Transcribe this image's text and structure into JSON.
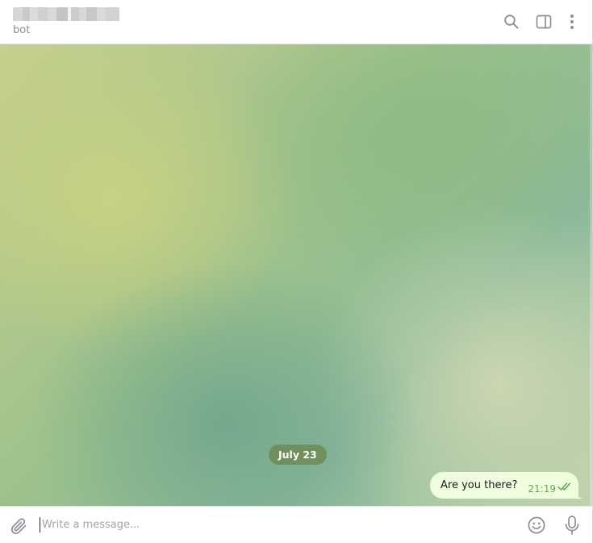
{
  "header": {
    "status": "bot",
    "icons": [
      "search-icon",
      "sidebar-toggle-icon",
      "more-vertical-icon"
    ]
  },
  "chat": {
    "date_label": "July 23",
    "messages": [
      {
        "text": "Are you there?",
        "time": "21:19",
        "outgoing": true,
        "status": "read"
      }
    ]
  },
  "composer": {
    "placeholder": "Write a message...",
    "icons": [
      "paperclip-icon",
      "emoji-icon",
      "microphone-icon"
    ]
  },
  "colors": {
    "outgoing_bubble": "#effdde",
    "time_and_check": "#5fa85a",
    "date_pill": "#6e8750",
    "icon": "#8a8f94"
  }
}
